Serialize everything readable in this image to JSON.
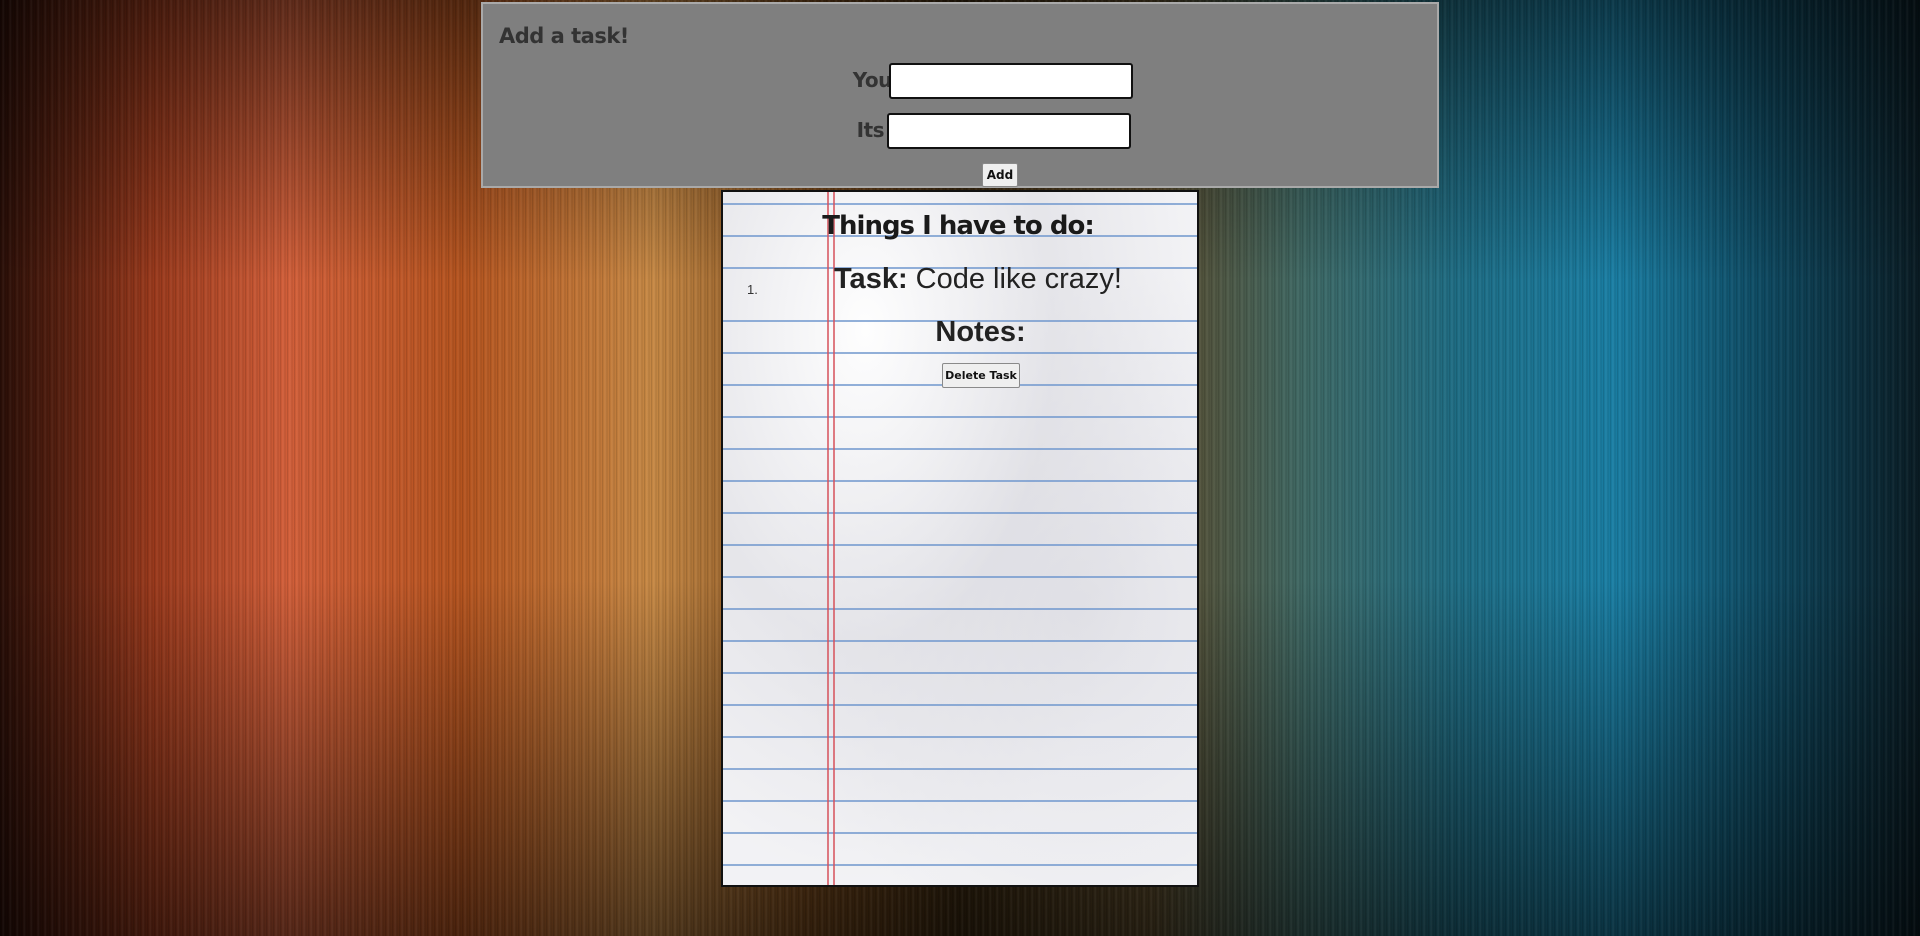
{
  "add_panel": {
    "title": "Add a task!",
    "task_label": "Your Task:",
    "task_value": "",
    "notes_label": "Its Notes:",
    "notes_value": "",
    "add_button": "Add",
    "background_color": "#7f7f7f"
  },
  "notepad": {
    "title": "Things I have to do:",
    "tasks": [
      {
        "number": "1.",
        "task_label": "Task:",
        "task_text": "Code like crazy!",
        "notes_label": "Notes:",
        "notes_text": "",
        "delete_button": "Delete Task"
      }
    ]
  }
}
